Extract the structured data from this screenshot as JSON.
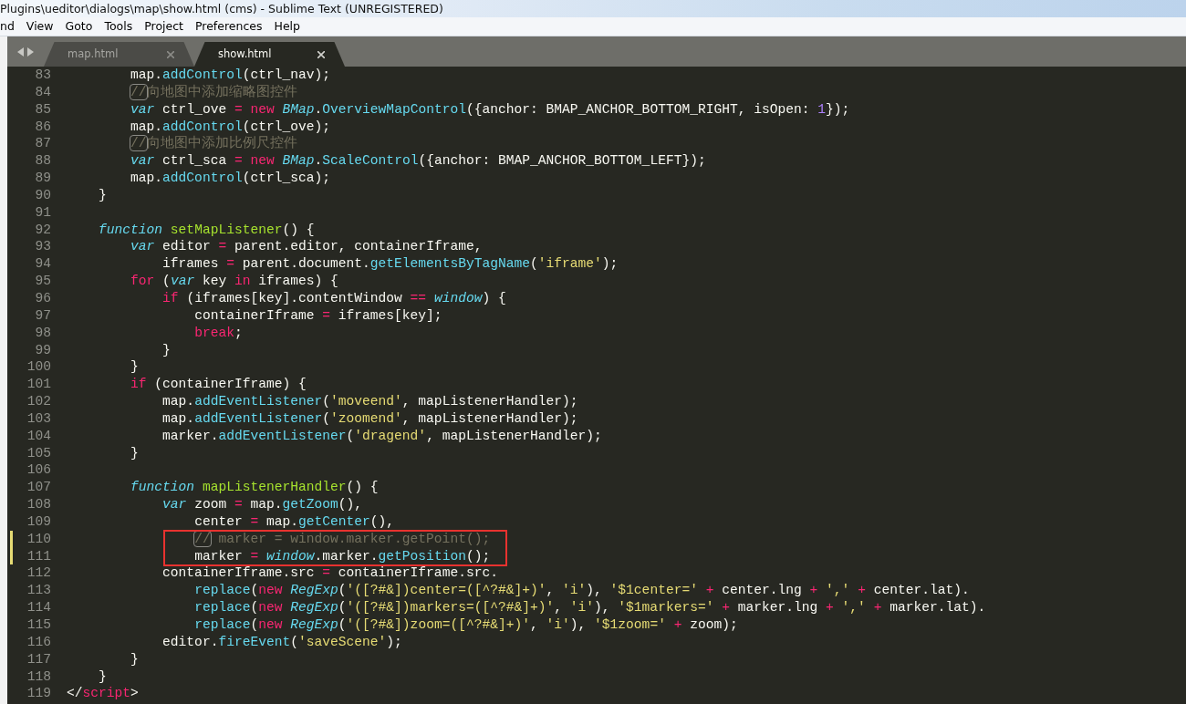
{
  "window": {
    "title": "Plugins\\ueditor\\dialogs\\map\\show.html (cms) - Sublime Text (UNREGISTERED)"
  },
  "menu": [
    "nd",
    "View",
    "Goto",
    "Tools",
    "Project",
    "Preferences",
    "Help"
  ],
  "tabs": [
    {
      "label": "map.html",
      "selected": false
    },
    {
      "label": "show.html",
      "selected": true
    }
  ],
  "editor": {
    "lines": [
      {
        "number": "83",
        "modified": false,
        "boxed": false,
        "tokens": [
          {
            "kind": "plain",
            "text": "        map."
          },
          {
            "kind": "support",
            "text": "addControl"
          },
          {
            "kind": "plain",
            "text": "(ctrl_nav);"
          }
        ]
      },
      {
        "number": "84",
        "modified": false,
        "boxed": false,
        "tokens": [
          {
            "kind": "delim",
            "text": "        //"
          },
          {
            "kind": "comment",
            "text": "向地图中添加缩略图控件"
          }
        ]
      },
      {
        "number": "85",
        "modified": false,
        "boxed": false,
        "tokens": [
          {
            "kind": "storage",
            "text": "        var"
          },
          {
            "kind": "plain",
            "text": " ctrl_ove "
          },
          {
            "kind": "operator",
            "text": "="
          },
          {
            "kind": "keyword",
            "text": " new"
          },
          {
            "kind": "class",
            "text": " BMap"
          },
          {
            "kind": "plain",
            "text": "."
          },
          {
            "kind": "support",
            "text": "OverviewMapControl"
          },
          {
            "kind": "plain",
            "text": "({anchor: BMAP_ANCHOR_BOTTOM_RIGHT, isOpen: "
          },
          {
            "kind": "number",
            "text": "1"
          },
          {
            "kind": "plain",
            "text": "});"
          }
        ]
      },
      {
        "number": "86",
        "modified": false,
        "boxed": false,
        "tokens": [
          {
            "kind": "plain",
            "text": "        map."
          },
          {
            "kind": "support",
            "text": "addControl"
          },
          {
            "kind": "plain",
            "text": "(ctrl_ove);"
          }
        ]
      },
      {
        "number": "87",
        "modified": false,
        "boxed": false,
        "tokens": [
          {
            "kind": "delim",
            "text": "        //"
          },
          {
            "kind": "comment",
            "text": "向地图中添加比例尺控件"
          }
        ]
      },
      {
        "number": "88",
        "modified": false,
        "boxed": false,
        "tokens": [
          {
            "kind": "storage",
            "text": "        var"
          },
          {
            "kind": "plain",
            "text": " ctrl_sca "
          },
          {
            "kind": "operator",
            "text": "="
          },
          {
            "kind": "keyword",
            "text": " new"
          },
          {
            "kind": "class",
            "text": " BMap"
          },
          {
            "kind": "plain",
            "text": "."
          },
          {
            "kind": "support",
            "text": "ScaleControl"
          },
          {
            "kind": "plain",
            "text": "({anchor: BMAP_ANCHOR_BOTTOM_LEFT});"
          }
        ]
      },
      {
        "number": "89",
        "modified": false,
        "boxed": false,
        "tokens": [
          {
            "kind": "plain",
            "text": "        map."
          },
          {
            "kind": "support",
            "text": "addControl"
          },
          {
            "kind": "plain",
            "text": "(ctrl_sca);"
          }
        ]
      },
      {
        "number": "90",
        "modified": false,
        "boxed": false,
        "tokens": [
          {
            "kind": "plain",
            "text": "    }"
          }
        ]
      },
      {
        "number": "91",
        "modified": false,
        "boxed": false
      },
      {
        "number": "92",
        "modified": false,
        "boxed": false,
        "tokens": [
          {
            "kind": "storage",
            "text": "    function"
          },
          {
            "kind": "entity",
            "text": " setMapListener"
          },
          {
            "kind": "plain",
            "text": "() {"
          }
        ]
      },
      {
        "number": "93",
        "modified": false,
        "boxed": false,
        "tokens": [
          {
            "kind": "storage",
            "text": "        var"
          },
          {
            "kind": "plain",
            "text": " editor "
          },
          {
            "kind": "operator",
            "text": "="
          },
          {
            "kind": "plain",
            "text": " parent.editor, containerIframe,"
          }
        ]
      },
      {
        "number": "94",
        "modified": false,
        "boxed": false,
        "tokens": [
          {
            "kind": "plain",
            "text": "            iframes "
          },
          {
            "kind": "operator",
            "text": "="
          },
          {
            "kind": "plain",
            "text": " parent.document."
          },
          {
            "kind": "support",
            "text": "getElementsByTagName"
          },
          {
            "kind": "plain",
            "text": "("
          },
          {
            "kind": "string",
            "text": "'iframe'"
          },
          {
            "kind": "plain",
            "text": ");"
          }
        ]
      },
      {
        "number": "95",
        "modified": false,
        "boxed": false,
        "tokens": [
          {
            "kind": "keyword",
            "text": "        for"
          },
          {
            "kind": "plain",
            "text": " ("
          },
          {
            "kind": "storage",
            "text": "var"
          },
          {
            "kind": "plain",
            "text": " key "
          },
          {
            "kind": "keyword",
            "text": "in"
          },
          {
            "kind": "plain",
            "text": " iframes) {"
          }
        ]
      },
      {
        "number": "96",
        "modified": false,
        "boxed": false,
        "tokens": [
          {
            "kind": "keyword",
            "text": "            if"
          },
          {
            "kind": "plain",
            "text": " (iframes[key].contentWindow "
          },
          {
            "kind": "operator",
            "text": "=="
          },
          {
            "kind": "class",
            "text": " window"
          },
          {
            "kind": "plain",
            "text": ") {"
          }
        ]
      },
      {
        "number": "97",
        "modified": false,
        "boxed": false,
        "tokens": [
          {
            "kind": "plain",
            "text": "                containerIframe "
          },
          {
            "kind": "operator",
            "text": "="
          },
          {
            "kind": "plain",
            "text": " iframes[key];"
          }
        ]
      },
      {
        "number": "98",
        "modified": false,
        "boxed": false,
        "tokens": [
          {
            "kind": "keyword",
            "text": "                break"
          },
          {
            "kind": "plain",
            "text": ";"
          }
        ]
      },
      {
        "number": "99",
        "modified": false,
        "boxed": false,
        "tokens": [
          {
            "kind": "plain",
            "text": "            }"
          }
        ]
      },
      {
        "number": "100",
        "modified": false,
        "boxed": false,
        "tokens": [
          {
            "kind": "plain",
            "text": "        }"
          }
        ]
      },
      {
        "number": "101",
        "modified": false,
        "boxed": false,
        "tokens": [
          {
            "kind": "keyword",
            "text": "        if"
          },
          {
            "kind": "plain",
            "text": " (containerIframe) {"
          }
        ]
      },
      {
        "number": "102",
        "modified": false,
        "boxed": false,
        "tokens": [
          {
            "kind": "plain",
            "text": "            map."
          },
          {
            "kind": "support",
            "text": "addEventListener"
          },
          {
            "kind": "plain",
            "text": "("
          },
          {
            "kind": "string",
            "text": "'moveend'"
          },
          {
            "kind": "plain",
            "text": ", mapListenerHandler);"
          }
        ]
      },
      {
        "number": "103",
        "modified": false,
        "boxed": false,
        "tokens": [
          {
            "kind": "plain",
            "text": "            map."
          },
          {
            "kind": "support",
            "text": "addEventListener"
          },
          {
            "kind": "plain",
            "text": "("
          },
          {
            "kind": "string",
            "text": "'zoomend'"
          },
          {
            "kind": "plain",
            "text": ", mapListenerHandler);"
          }
        ]
      },
      {
        "number": "104",
        "modified": false,
        "boxed": false,
        "tokens": [
          {
            "kind": "plain",
            "text": "            marker."
          },
          {
            "kind": "support",
            "text": "addEventListener"
          },
          {
            "kind": "plain",
            "text": "("
          },
          {
            "kind": "string",
            "text": "'dragend'"
          },
          {
            "kind": "plain",
            "text": ", mapListenerHandler);"
          }
        ]
      },
      {
        "number": "105",
        "modified": false,
        "boxed": false,
        "tokens": [
          {
            "kind": "plain",
            "text": "        }"
          }
        ]
      },
      {
        "number": "106",
        "modified": false,
        "boxed": false
      },
      {
        "number": "107",
        "modified": false,
        "boxed": false,
        "tokens": [
          {
            "kind": "storage",
            "text": "        function"
          },
          {
            "kind": "entity",
            "text": " mapListenerHandler"
          },
          {
            "kind": "plain",
            "text": "() {"
          }
        ]
      },
      {
        "number": "108",
        "modified": false,
        "boxed": false,
        "tokens": [
          {
            "kind": "storage",
            "text": "            var"
          },
          {
            "kind": "plain",
            "text": " zoom "
          },
          {
            "kind": "operator",
            "text": "="
          },
          {
            "kind": "plain",
            "text": " map."
          },
          {
            "kind": "support",
            "text": "getZoom"
          },
          {
            "kind": "plain",
            "text": "(),"
          }
        ]
      },
      {
        "number": "109",
        "modified": false,
        "boxed": false,
        "tokens": [
          {
            "kind": "plain",
            "text": "                center "
          },
          {
            "kind": "operator",
            "text": "="
          },
          {
            "kind": "plain",
            "text": " map."
          },
          {
            "kind": "support",
            "text": "getCenter"
          },
          {
            "kind": "plain",
            "text": "(),"
          }
        ]
      },
      {
        "number": "110",
        "modified": true,
        "boxed": true,
        "tokens": [
          {
            "kind": "delim",
            "text": "                //"
          },
          {
            "kind": "comment",
            "text": " marker = window.marker.getPoint();"
          }
        ]
      },
      {
        "number": "111",
        "modified": true,
        "boxed": true,
        "tokens": [
          {
            "kind": "plain",
            "text": "                marker "
          },
          {
            "kind": "operator",
            "text": "="
          },
          {
            "kind": "class",
            "text": " window"
          },
          {
            "kind": "plain",
            "text": ".marker."
          },
          {
            "kind": "support",
            "text": "getPosition"
          },
          {
            "kind": "plain",
            "text": "();"
          }
        ]
      },
      {
        "number": "112",
        "modified": false,
        "boxed": false,
        "tokens": [
          {
            "kind": "plain",
            "text": "            containerIframe.src "
          },
          {
            "kind": "operator",
            "text": "="
          },
          {
            "kind": "plain",
            "text": " containerIframe.src."
          }
        ]
      },
      {
        "number": "113",
        "modified": false,
        "boxed": false,
        "tokens": [
          {
            "kind": "support",
            "text": "                replace"
          },
          {
            "kind": "plain",
            "text": "("
          },
          {
            "kind": "keyword",
            "text": "new"
          },
          {
            "kind": "class",
            "text": " RegExp"
          },
          {
            "kind": "plain",
            "text": "("
          },
          {
            "kind": "string",
            "text": "'([?#&])center=([^?#&]+)'"
          },
          {
            "kind": "plain",
            "text": ", "
          },
          {
            "kind": "string",
            "text": "'i'"
          },
          {
            "kind": "plain",
            "text": "), "
          },
          {
            "kind": "string",
            "text": "'$1center='"
          },
          {
            "kind": "operator",
            "text": " +"
          },
          {
            "kind": "plain",
            "text": " center.lng "
          },
          {
            "kind": "operator",
            "text": "+"
          },
          {
            "kind": "string",
            "text": " ','"
          },
          {
            "kind": "operator",
            "text": " +"
          },
          {
            "kind": "plain",
            "text": " center.lat)."
          }
        ]
      },
      {
        "number": "114",
        "modified": false,
        "boxed": false,
        "tokens": [
          {
            "kind": "support",
            "text": "                replace"
          },
          {
            "kind": "plain",
            "text": "("
          },
          {
            "kind": "keyword",
            "text": "new"
          },
          {
            "kind": "class",
            "text": " RegExp"
          },
          {
            "kind": "plain",
            "text": "("
          },
          {
            "kind": "string",
            "text": "'([?#&])markers=([^?#&]+)'"
          },
          {
            "kind": "plain",
            "text": ", "
          },
          {
            "kind": "string",
            "text": "'i'"
          },
          {
            "kind": "plain",
            "text": "), "
          },
          {
            "kind": "string",
            "text": "'$1markers='"
          },
          {
            "kind": "operator",
            "text": " +"
          },
          {
            "kind": "plain",
            "text": " marker.lng "
          },
          {
            "kind": "operator",
            "text": "+"
          },
          {
            "kind": "string",
            "text": " ','"
          },
          {
            "kind": "operator",
            "text": " +"
          },
          {
            "kind": "plain",
            "text": " marker.lat)."
          }
        ]
      },
      {
        "number": "115",
        "modified": false,
        "boxed": false,
        "tokens": [
          {
            "kind": "support",
            "text": "                replace"
          },
          {
            "kind": "plain",
            "text": "("
          },
          {
            "kind": "keyword",
            "text": "new"
          },
          {
            "kind": "class",
            "text": " RegExp"
          },
          {
            "kind": "plain",
            "text": "("
          },
          {
            "kind": "string",
            "text": "'([?#&])zoom=([^?#&]+)'"
          },
          {
            "kind": "plain",
            "text": ", "
          },
          {
            "kind": "string",
            "text": "'i'"
          },
          {
            "kind": "plain",
            "text": "), "
          },
          {
            "kind": "string",
            "text": "'$1zoom='"
          },
          {
            "kind": "operator",
            "text": " +"
          },
          {
            "kind": "plain",
            "text": " zoom);"
          }
        ]
      },
      {
        "number": "116",
        "modified": false,
        "boxed": false,
        "tokens": [
          {
            "kind": "plain",
            "text": "            editor."
          },
          {
            "kind": "support",
            "text": "fireEvent"
          },
          {
            "kind": "plain",
            "text": "("
          },
          {
            "kind": "string",
            "text": "'saveScene'"
          },
          {
            "kind": "plain",
            "text": ");"
          }
        ]
      },
      {
        "number": "117",
        "modified": false,
        "boxed": false,
        "tokens": [
          {
            "kind": "plain",
            "text": "        }"
          }
        ]
      },
      {
        "number": "118",
        "modified": false,
        "boxed": false,
        "tokens": [
          {
            "kind": "plain",
            "text": "    }"
          }
        ]
      },
      {
        "number": "119",
        "modified": false,
        "boxed": false,
        "tokens": [
          {
            "kind": "plain",
            "text": "</"
          },
          {
            "kind": "keyword",
            "text": "script"
          },
          {
            "kind": "plain",
            "text": ">"
          }
        ]
      }
    ]
  }
}
